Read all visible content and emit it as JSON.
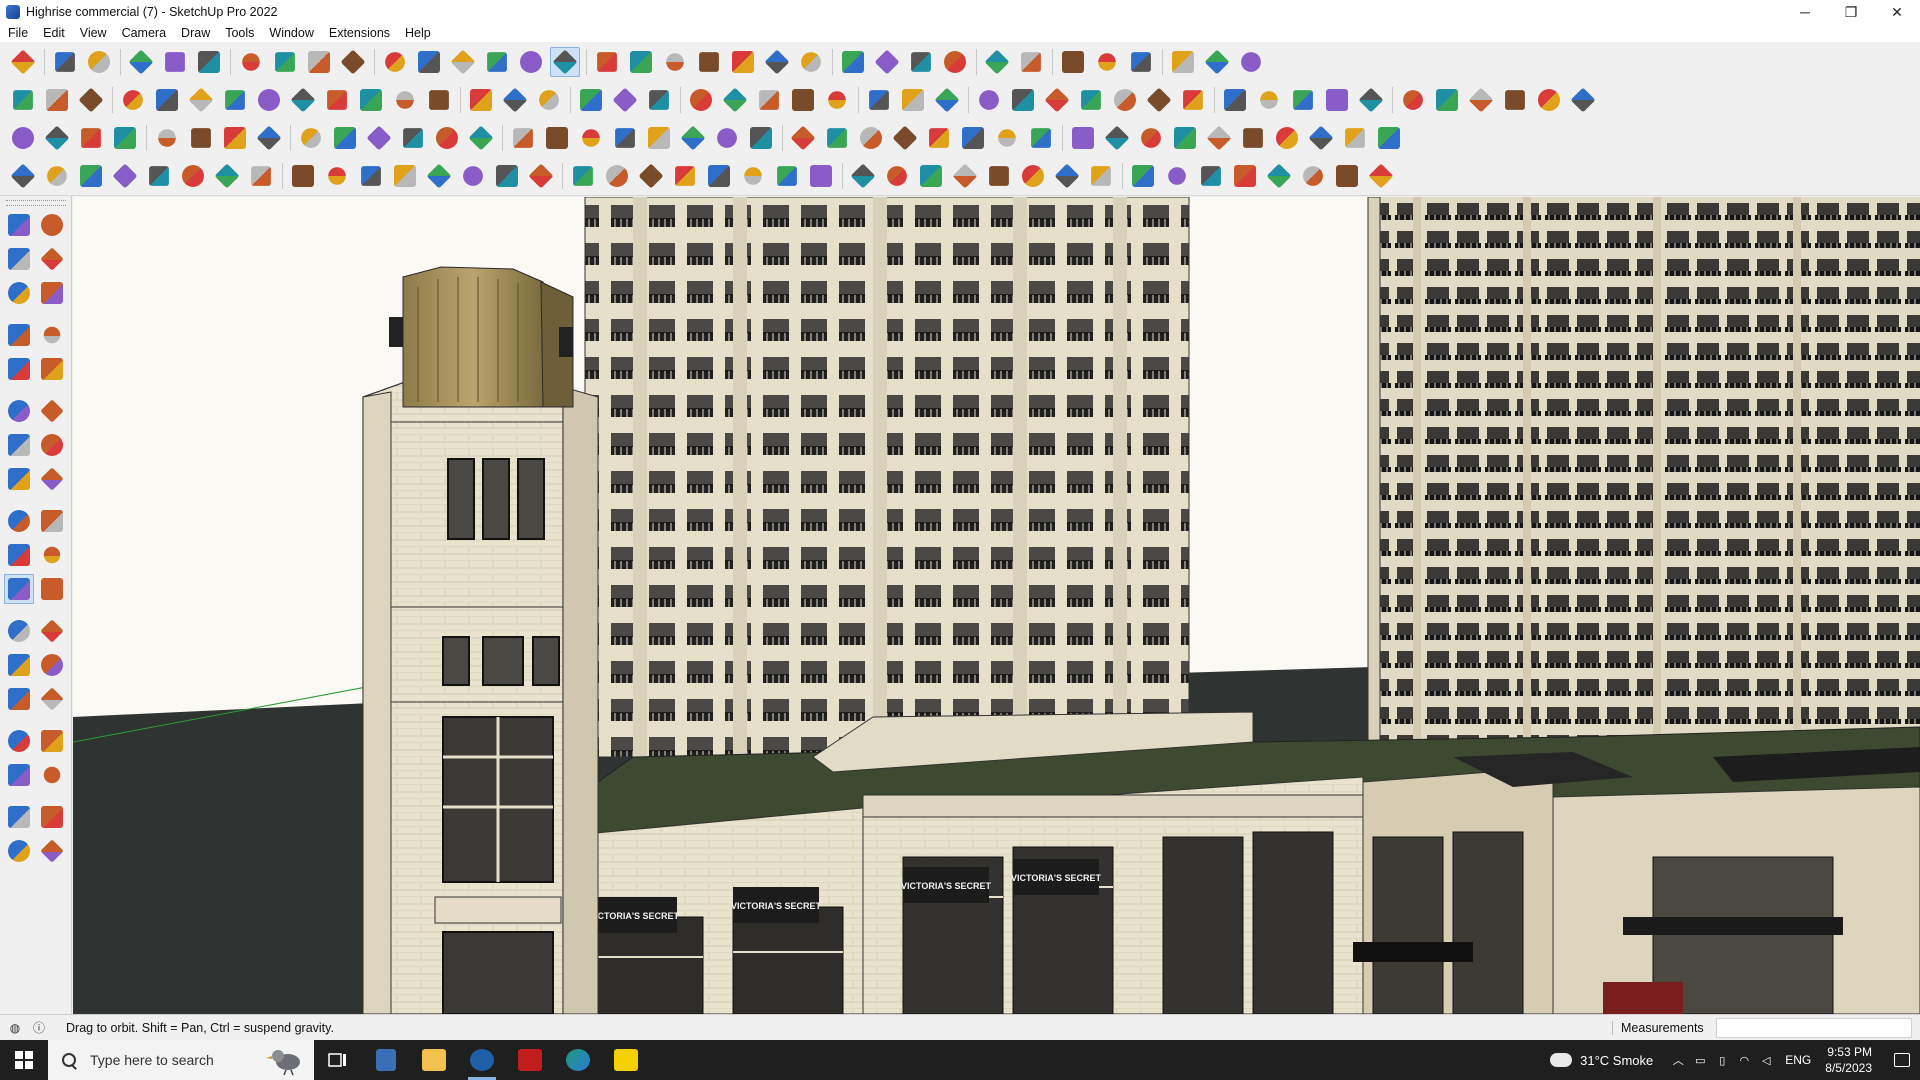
{
  "window": {
    "title": "Highrise commercial (7) - SketchUp Pro 2022",
    "controls": [
      "─",
      "❐",
      "✕"
    ]
  },
  "menu": [
    "File",
    "Edit",
    "View",
    "Camera",
    "Draw",
    "Tools",
    "Window",
    "Extensions",
    "Help"
  ],
  "viewport": {
    "signage": [
      "VICTORIA'S SECRET",
      "VICTORIA'S SECRET",
      "VICTORIA'S SECRET",
      "VICTORIA'S SECRET"
    ]
  },
  "status": {
    "message": "Drag to orbit. Shift = Pan, Ctrl = suspend gravity.",
    "measurements_label": "Measurements",
    "measurements_value": ""
  },
  "taskbar": {
    "search_placeholder": "Type here to search",
    "weather": "31°C  Smoke",
    "language": "ENG",
    "time": "9:53 PM",
    "date": "8/5/2023"
  },
  "colors": {
    "sky": "#fbf9f3",
    "ground": "#2e3230",
    "facade": "#e7e0cb",
    "roof_green": "#3f4a30",
    "glass": "#3b3a36",
    "accent_active": "#cfe1f6"
  }
}
